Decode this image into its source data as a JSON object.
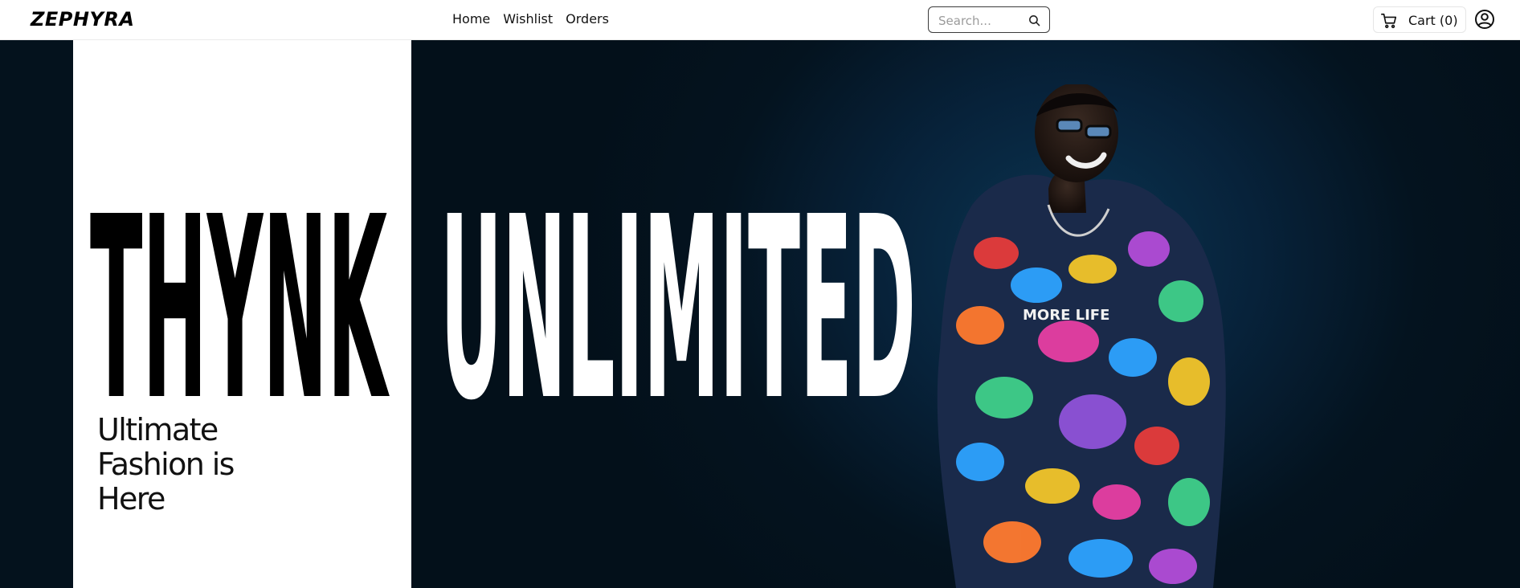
{
  "brand": {
    "logo": "ZEPHYRA"
  },
  "nav": [
    {
      "label": "Home"
    },
    {
      "label": "Wishlist"
    },
    {
      "label": "Orders"
    }
  ],
  "search": {
    "placeholder": "Search...",
    "icon": "search-icon"
  },
  "cart": {
    "label": "Cart (0)",
    "icon": "cart-icon"
  },
  "account": {
    "icon": "user-circle-icon"
  },
  "hero": {
    "word_left": "THYNK",
    "word_right": "UNLIMITED",
    "tagline": [
      "Ultimate",
      "Fashion is",
      "Here"
    ],
    "hoodie_print": "MORE LIFE"
  },
  "colors": {
    "accent_dark": "#03101a",
    "panel": "#ffffff",
    "text": "#000000"
  }
}
